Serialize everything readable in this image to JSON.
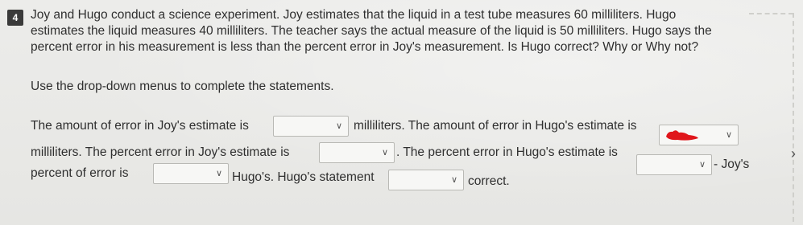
{
  "question": {
    "number": "4",
    "lines": [
      "Joy and Hugo conduct a science experiment. Joy estimates that the liquid in a test tube measures 60 milliliters. Hugo",
      "estimates the liquid measures 40 milliliters. The teacher says the actual measure of the liquid is 50 milliliters. Hugo says the",
      "percent error in his measurement is less than the percent error in Joy's measurement. Is Hugo correct? Why or Why not?"
    ],
    "instruction": "Use the drop-down menus to complete the statements."
  },
  "statements": {
    "s1_before": "The amount of error in Joy's estimate is",
    "s1_after": "milliliters. The amount of error in Hugo's estimate is",
    "s2_before": "milliliters. The percent error in Joy's estimate is",
    "s2_mid": ". The percent error in Hugo's estimate is",
    "s2_after": "- Joy's",
    "s3_before": "percent of error is",
    "s3_mid": "Hugo's. Hugo's statement",
    "s3_after": "correct."
  },
  "dropdowns": {
    "joy_error": {
      "value": ""
    },
    "hugo_error": {
      "value": "",
      "highlight_color": "#e0161b"
    },
    "joy_percent": {
      "value": ""
    },
    "hugo_percent": {
      "value": ""
    },
    "comparison": {
      "value": ""
    },
    "statement_truth": {
      "value": ""
    }
  },
  "icons": {
    "chevron": "chevron-down-icon",
    "next": "chevron-right-icon"
  },
  "colors": {
    "background": "#e9e9e6",
    "text": "#2f2f2f",
    "number_badge": "#3a3a3a"
  }
}
